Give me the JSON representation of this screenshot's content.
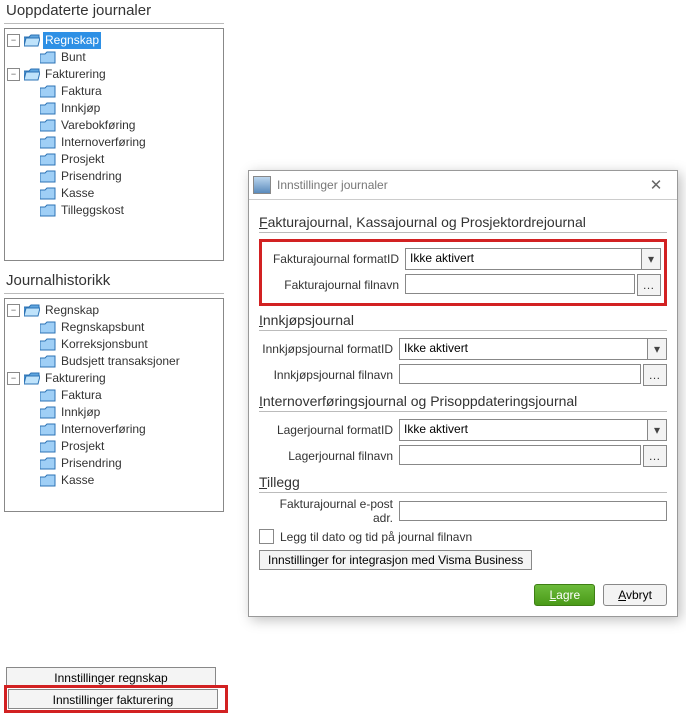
{
  "panel1": {
    "title": "Uoppdaterte journaler",
    "root": {
      "label": "Regnskap",
      "children": [
        "Bunt"
      ]
    },
    "root2": {
      "label": "Fakturering",
      "children": [
        "Faktura",
        "Innkjøp",
        "Varebokføring",
        "Internoverføring",
        "Prosjekt",
        "Prisendring",
        "Kasse",
        "Tilleggskost"
      ]
    }
  },
  "panel2": {
    "title": "Journalhistorikk",
    "root": {
      "label": "Regnskap",
      "children": [
        "Regnskapsbunt",
        "Korreksjonsbunt",
        "Budsjett transaksjoner"
      ]
    },
    "root2": {
      "label": "Fakturering",
      "children": [
        "Faktura",
        "Innkjøp",
        "Internoverføring",
        "Prosjekt",
        "Prisendring",
        "Kasse"
      ]
    }
  },
  "buttons": {
    "b1": "Innstillinger regnskap",
    "b2": "Innstillinger fakturering"
  },
  "dialog": {
    "title": "Innstillinger journaler",
    "sec1_title_pre": "F",
    "sec1_title_rest": "akturajournal, Kassajournal og Prosjektordrejournal",
    "sec1": {
      "row1_label": "Fakturajournal formatID",
      "row1_value": "Ikke aktivert",
      "row2_label": "Fakturajournal filnavn",
      "row2_value": ""
    },
    "sec2_title_pre": "I",
    "sec2_title_rest": "nnkjøpsjournal",
    "sec2": {
      "row1_label": "Innkjøpsjournal formatID",
      "row1_value": "Ikke aktivert",
      "row2_label": "Innkjøpsjournal filnavn",
      "row2_value": ""
    },
    "sec3_title_pre": "I",
    "sec3_title_rest": "nternoverføringsjournal og Prisoppdateringsjournal",
    "sec3": {
      "row1_label": "Lagerjournal formatID",
      "row1_value": "Ikke aktivert",
      "row2_label": "Lagerjournal filnavn",
      "row2_value": ""
    },
    "sec4_title_pre": "T",
    "sec4_title_rest": "illegg",
    "sec4": {
      "row1_label": "Fakturajournal e-post adr.",
      "row1_value": ""
    },
    "chk_label": "Legg til dato og tid på journal filnavn",
    "integration_btn": "Innstillinger for integrasjon med Visma Business",
    "save_pre": "L",
    "save_rest": "agre",
    "cancel_pre": "A",
    "cancel_rest": "vbryt"
  }
}
